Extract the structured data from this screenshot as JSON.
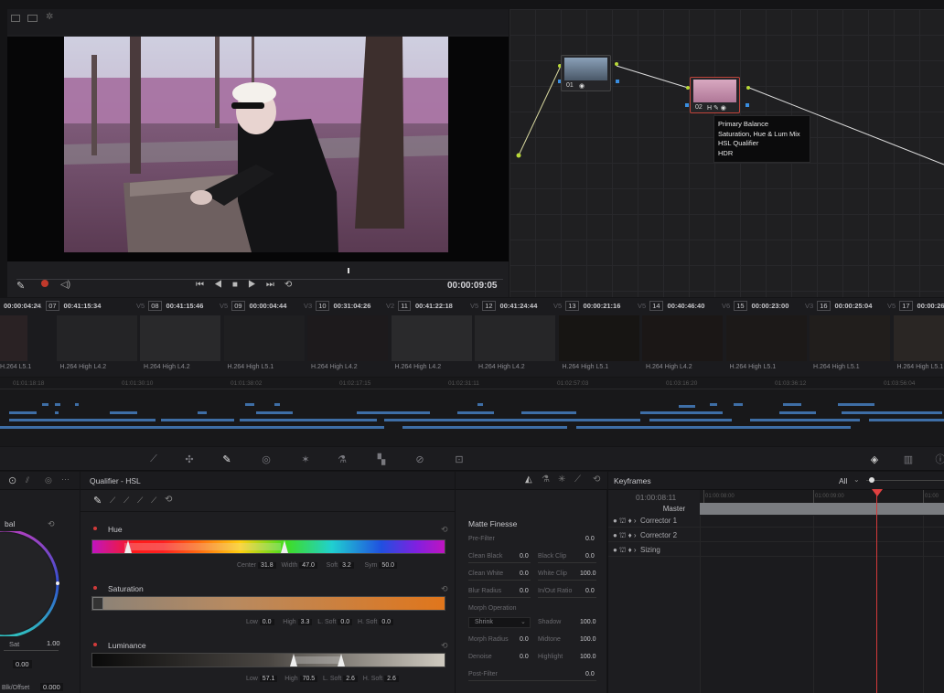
{
  "viewer": {
    "timecode": "00:00:09:05"
  },
  "nodes": [
    {
      "label": "01"
    },
    {
      "label": "02"
    }
  ],
  "node_tooltip": {
    "items": [
      "Primary Balance",
      "Saturation, Hue & Lum Mix",
      "HSL Qualifier",
      "HDR"
    ]
  },
  "clips": {
    "header": [
      {
        "tc": "00:00:04:24",
        "track": "",
        "num": ""
      },
      {
        "tc": "00:41:15:34",
        "track": "V1",
        "num": "07"
      },
      {
        "tc": "00:41:15:46",
        "track": "V5",
        "num": "08"
      },
      {
        "tc": "00:00:04:44",
        "track": "V5",
        "num": "09"
      },
      {
        "tc": "00:31:04:26",
        "track": "V3",
        "num": "10"
      },
      {
        "tc": "00:41:22:18",
        "track": "V2",
        "num": "11"
      },
      {
        "tc": "00:41:24:44",
        "track": "V5",
        "num": "12"
      },
      {
        "tc": "00:00:21:16",
        "track": "V5",
        "num": "13"
      },
      {
        "tc": "00:40:46:40",
        "track": "V5",
        "num": "14"
      },
      {
        "tc": "00:00:23:00",
        "track": "V6",
        "num": "15"
      },
      {
        "tc": "00:00:25:04",
        "track": "V3",
        "num": "16"
      },
      {
        "tc": "00:00:26:2",
        "track": "V5",
        "num": "17"
      }
    ],
    "codecs": [
      "H.264 L5.1",
      "H.264 High L4.2",
      "H.264 High L4.2",
      "H.264 High L5.1",
      "H.264 High L4.2",
      "H.264 High L4.2",
      "H.264 High L4.2",
      "H.264 High L5.1",
      "H.264 High L4.2",
      "H.264 High L5.1",
      "H.264 High L5.1",
      "H.264 High L5.1"
    ]
  },
  "timeline": {
    "ticks": [
      "01:01:18:18",
      "01:01:30:10",
      "01:01:38:02",
      "01:02:17:15",
      "01:02:31:11",
      "01:02:57:03",
      "01:03:16:20",
      "01:03:36:12",
      "01:03:56:04"
    ]
  },
  "qualifier": {
    "title": "Qualifier - HSL",
    "hue": {
      "label": "Hue",
      "center_label": "Center",
      "center": "31.8",
      "width_label": "Width",
      "width": "47.0",
      "soft_label": "Soft",
      "soft": "3.2",
      "sym_label": "Sym",
      "sym": "50.0"
    },
    "saturation": {
      "label": "Saturation",
      "low_label": "Low",
      "low": "0.0",
      "high_label": "High",
      "high": "3.3",
      "lsoft_label": "L. Soft",
      "lsoft": "0.0",
      "hsoft_label": "H. Soft",
      "hsoft": "0.0"
    },
    "luminance": {
      "label": "Luminance",
      "low_label": "Low",
      "low": "57.1",
      "high_label": "High",
      "high": "70.5",
      "lsoft_label": "L. Soft",
      "lsoft": "2.6",
      "hsoft_label": "H. Soft",
      "hsoft": "2.6"
    }
  },
  "left_panel": {
    "title": "bal",
    "sat_label": "Sat",
    "sat": "1.00",
    "field2": "0.00",
    "offset_label": "Blk/Offset",
    "offset": "0.000"
  },
  "matte": {
    "title": "Matte Finesse",
    "pre_filter_label": "Pre-Filter",
    "pre_filter": "0.0",
    "clean_black_label": "Clean Black",
    "clean_black": "0.0",
    "black_clip_label": "Black Clip",
    "black_clip": "0.0",
    "clean_white_label": "Clean White",
    "clean_white": "0.0",
    "white_clip_label": "White Clip",
    "white_clip": "100.0",
    "blur_radius_label": "Blur Radius",
    "blur_radius": "0.0",
    "inout_ratio_label": "In/Out Ratio",
    "inout_ratio": "0.0",
    "morph_op_label": "Morph Operation",
    "morph_op": "Shrink",
    "shadow_label": "Shadow",
    "shadow": "100.0",
    "morph_radius_label": "Morph Radius",
    "morph_radius": "0.0",
    "midtone_label": "Midtone",
    "midtone": "100.0",
    "denoise_label": "Denoise",
    "denoise": "0.0",
    "highlight_label": "Highlight",
    "highlight": "100.0",
    "post_filter_label": "Post-Filter",
    "post_filter": "0.0"
  },
  "keyframes": {
    "title": "Keyframes",
    "filter": "All",
    "timecode": "01:00:08:11",
    "ruler": [
      "01:00:08:00",
      "01:00:09:00",
      "01:00"
    ],
    "master": "Master",
    "rows": [
      "Corrector 1",
      "Corrector 2",
      "Sizing"
    ]
  }
}
